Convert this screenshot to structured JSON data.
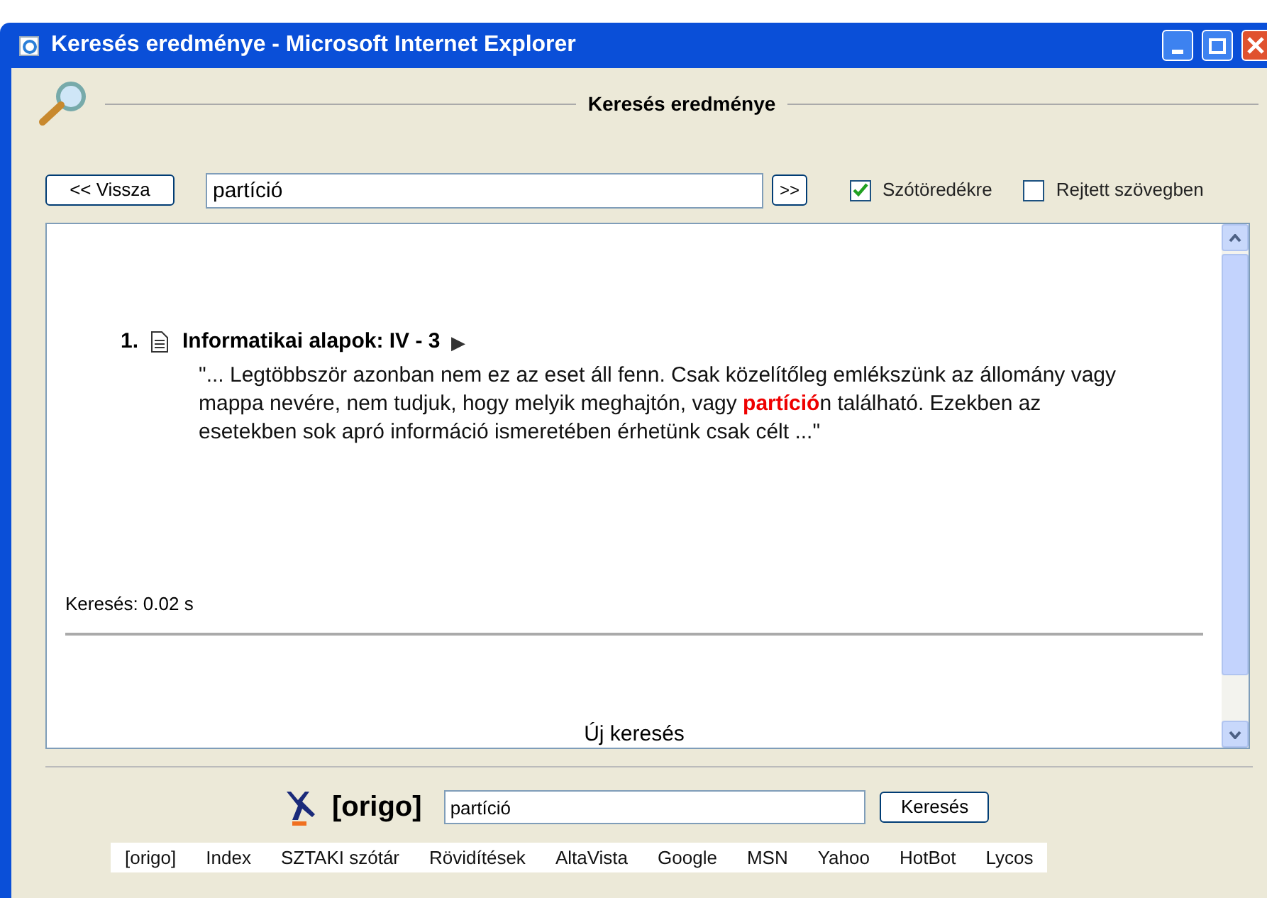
{
  "window": {
    "title": "Keresés eredménye - Microsoft Internet Explorer"
  },
  "header": {
    "title": "Keresés eredménye"
  },
  "toolbar": {
    "back_button": "<< Vissza",
    "query": "partíció",
    "next_button": ">>",
    "options": [
      {
        "label": "Szótöredékre",
        "checked": true
      },
      {
        "label": "Rejtett szövegben",
        "checked": false
      }
    ]
  },
  "results": [
    {
      "number": "1.",
      "title": "Informatikai alapok: IV - 3",
      "arrow": "▶",
      "snippet": "\"... Legtöbbször azonban nem ez az eset áll fenn. Csak közelítőleg emlékszünk az állomány vagy mappa nevére, nem tudjuk, hogy melyik meghajtón, vagy **partíció**n található. Ezekben az esetekben sok apró információ ismeretében érhetünk csak célt ...\""
    }
  ],
  "search_time": "Keresés: 0.02 s",
  "new_search": "Új keresés",
  "origo": {
    "logo": "[origo]",
    "query": "partíció",
    "button": "Keresés",
    "links": [
      "[origo]",
      "Index",
      "SZTAKI szótár",
      "Rövidítések",
      "AltaVista",
      "Google",
      "MSN",
      "Yahoo",
      "HotBot",
      "Lycos"
    ]
  }
}
